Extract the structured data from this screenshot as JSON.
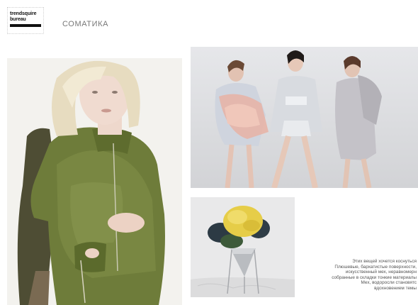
{
  "brand": {
    "logo_line1": "trendsquire",
    "logo_line2": "bureau"
  },
  "header": {
    "title": "СОМАТИКА"
  },
  "photos": [
    {
      "alt": ""
    },
    {
      "alt": ""
    },
    {
      "alt": ""
    }
  ],
  "caption": {
    "lines": [
      "Этих вещей хочется коснуться",
      "Плюшевые, бархатистые поверхности,",
      "искусственный мех, неравномерн",
      "собранные в складки тонкие материалы",
      "Мех, водоросли становятс",
      "вдохновением темы"
    ]
  },
  "colors": {
    "title_gray": "#777777",
    "velvet_green": "#6b7a38",
    "flower_yellow": "#e8cf4a",
    "studio_gray": "#d6d7da"
  }
}
